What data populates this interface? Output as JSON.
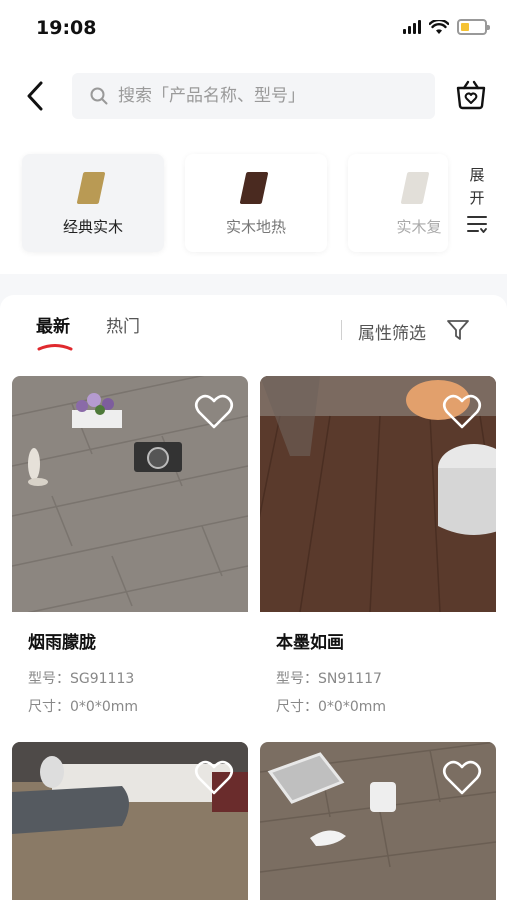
{
  "status_bar": {
    "time": "19:08",
    "battery_color": "#f5c233"
  },
  "header": {
    "search_placeholder": "搜索「产品名称、型号」",
    "search_icon": "search-icon",
    "back_icon": "chevron-left-icon",
    "fav_icon": "heart-basket-icon"
  },
  "categories": [
    {
      "label": "经典实木",
      "swatch": "#b99a54",
      "active": true
    },
    {
      "label": "实木地热",
      "swatch": "#4a2a20",
      "active": false
    },
    {
      "label": "实木复",
      "swatch": "#cfcac0",
      "active": false
    }
  ],
  "expand": {
    "line1": "展",
    "line2": "开"
  },
  "tabs": {
    "new": "最新",
    "hot": "热门",
    "accent": "#e0292e"
  },
  "filter": {
    "label": "属性筛选"
  },
  "products": [
    {
      "name": "烟雨朦胧",
      "model_label": "型号：",
      "model": "SG91113",
      "size_label": "尺寸：",
      "size": "0*0*0mm"
    },
    {
      "name": "本墨如画",
      "model_label": "型号：",
      "model": "SN91117",
      "size_label": "尺寸：",
      "size": "0*0*0mm"
    },
    {
      "name": "",
      "model_label": "",
      "model": "",
      "size_label": "",
      "size": ""
    },
    {
      "name": "",
      "model_label": "",
      "model": "",
      "size_label": "",
      "size": ""
    }
  ]
}
